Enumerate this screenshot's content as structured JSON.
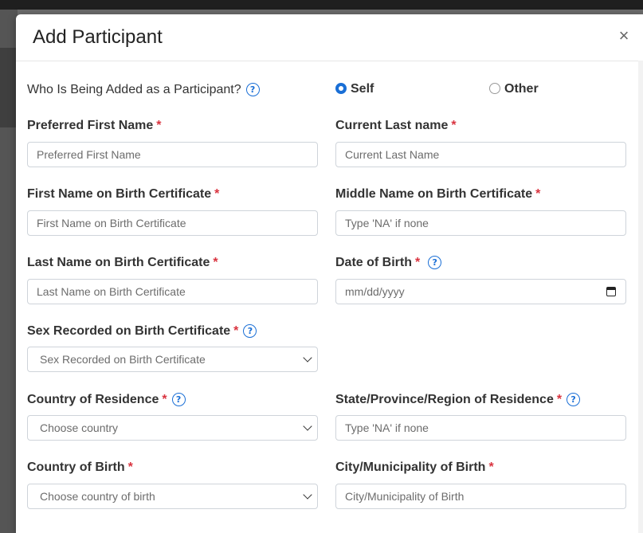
{
  "dialog": {
    "title": "Add Participant",
    "close": "×"
  },
  "who": {
    "label": "Who Is Being Added as a Participant?",
    "options": [
      {
        "label": "Self",
        "selected": true
      },
      {
        "label": "Other",
        "selected": false
      }
    ]
  },
  "fields": {
    "preferred_first": {
      "label": "Preferred First Name",
      "placeholder": "Preferred First Name"
    },
    "current_last": {
      "label": "Current Last name",
      "placeholder": "Current Last Name"
    },
    "first_bc": {
      "label": "First Name on Birth Certificate",
      "placeholder": "First Name on Birth Certificate"
    },
    "middle_bc": {
      "label": "Middle Name on Birth Certificate",
      "placeholder": "Type 'NA' if none"
    },
    "last_bc": {
      "label": "Last Name on Birth Certificate",
      "placeholder": "Last Name on Birth Certificate"
    },
    "dob": {
      "label": "Date of Birth",
      "placeholder": "mm/dd/yyyy"
    },
    "sex_bc": {
      "label": "Sex Recorded on Birth Certificate",
      "value": "Sex Recorded on Birth Certificate"
    },
    "country_res": {
      "label": "Country of Residence",
      "value": "Choose country"
    },
    "state_res": {
      "label": "State/Province/Region of Residence",
      "placeholder": "Type 'NA' if none"
    },
    "country_birth": {
      "label": "Country of Birth",
      "value": "Choose country of birth"
    },
    "city_birth": {
      "label": "City/Municipality of Birth",
      "placeholder": "City/Municipality of Birth"
    }
  },
  "required_mark": "*",
  "help_glyph": "?",
  "icons": [
    "close-icon",
    "help-icon",
    "calendar-icon",
    "chevron-down-icon"
  ],
  "colors": {
    "accent": "#1a6fd6",
    "required": "#d9333f",
    "border": "#cfd4da"
  }
}
